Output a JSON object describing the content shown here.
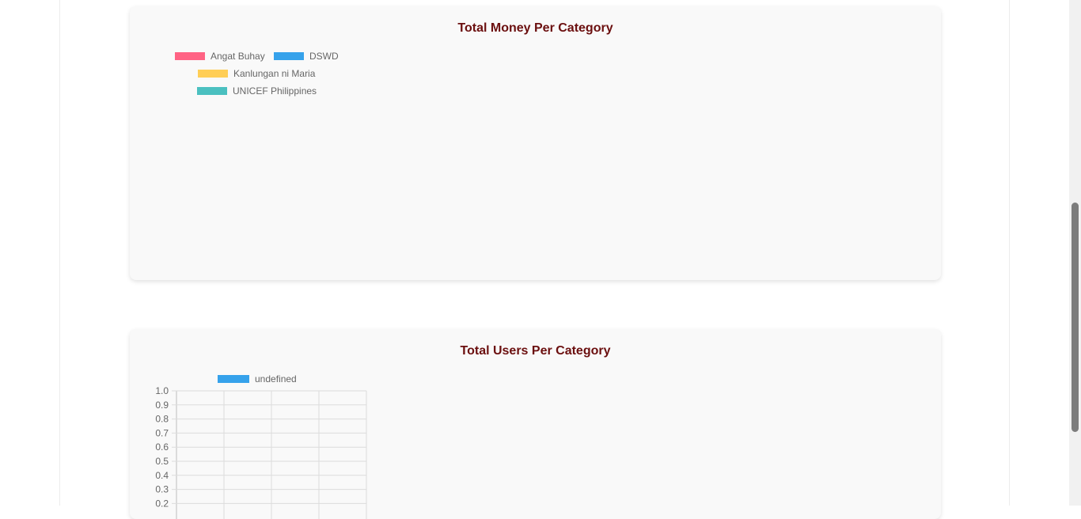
{
  "charts": {
    "money": {
      "title": "Total Money Per Category"
    },
    "users": {
      "title": "Total Users Per Category"
    }
  },
  "chart_data": [
    {
      "type": "pie",
      "title": "Total Money Per Category",
      "categories": [
        "Angat Buhay",
        "DSWD",
        "Kanlungan ni Maria",
        "UNICEF Philippines"
      ],
      "values": [],
      "colors": [
        "#ff6384",
        "#36a2eb",
        "#ffce56",
        "#4bc0c0"
      ],
      "legend_position": "top-left"
    },
    {
      "type": "bar",
      "title": "Total Users Per Category",
      "series": [
        {
          "name": "undefined",
          "values": [],
          "color": "#36a2eb"
        }
      ],
      "categories": [],
      "ylim": [
        0,
        1.0
      ],
      "y_ticks": [
        "1.0",
        "0.9",
        "0.8",
        "0.7",
        "0.6",
        "0.5",
        "0.4",
        "0.3",
        "0.2"
      ],
      "grid": true,
      "legend_position": "top-left"
    }
  ]
}
